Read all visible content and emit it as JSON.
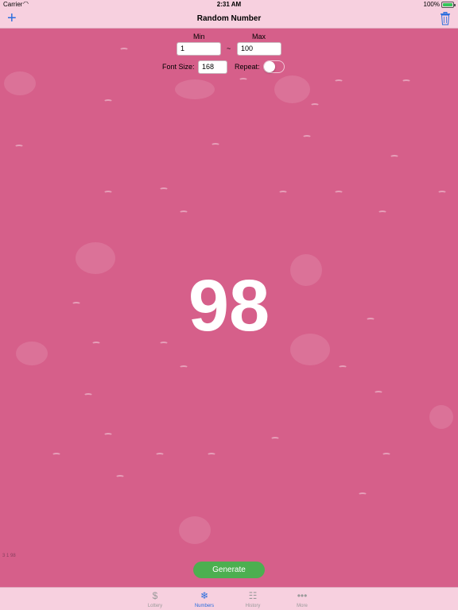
{
  "status": {
    "carrier": "Carrier",
    "time": "2:31 AM",
    "battery": "100%"
  },
  "nav": {
    "title": "Random Number",
    "add_icon": "plus-icon",
    "trash_icon": "trash-icon"
  },
  "range": {
    "min_label": "Min",
    "max_label": "Max",
    "min_value": "1",
    "separator": "~",
    "max_value": "100"
  },
  "options": {
    "font_size_label": "Font Size:",
    "font_size_value": "168",
    "repeat_label": "Repeat:",
    "repeat_on": false
  },
  "result": {
    "number": "98"
  },
  "debug_text": "3 1 98",
  "generate_label": "Generate",
  "tabs": [
    {
      "label": "Lottery",
      "icon": "dollar-icon",
      "active": false
    },
    {
      "label": "Numbers",
      "icon": "snowflake-icon",
      "active": true
    },
    {
      "label": "History",
      "icon": "document-icon",
      "active": false
    },
    {
      "label": "More",
      "icon": "more-dots-icon",
      "active": false
    }
  ],
  "colors": {
    "background": "#d65f8a",
    "bars": "#f7d0df",
    "accent": "#2a6dde",
    "generate": "#4caf50"
  }
}
